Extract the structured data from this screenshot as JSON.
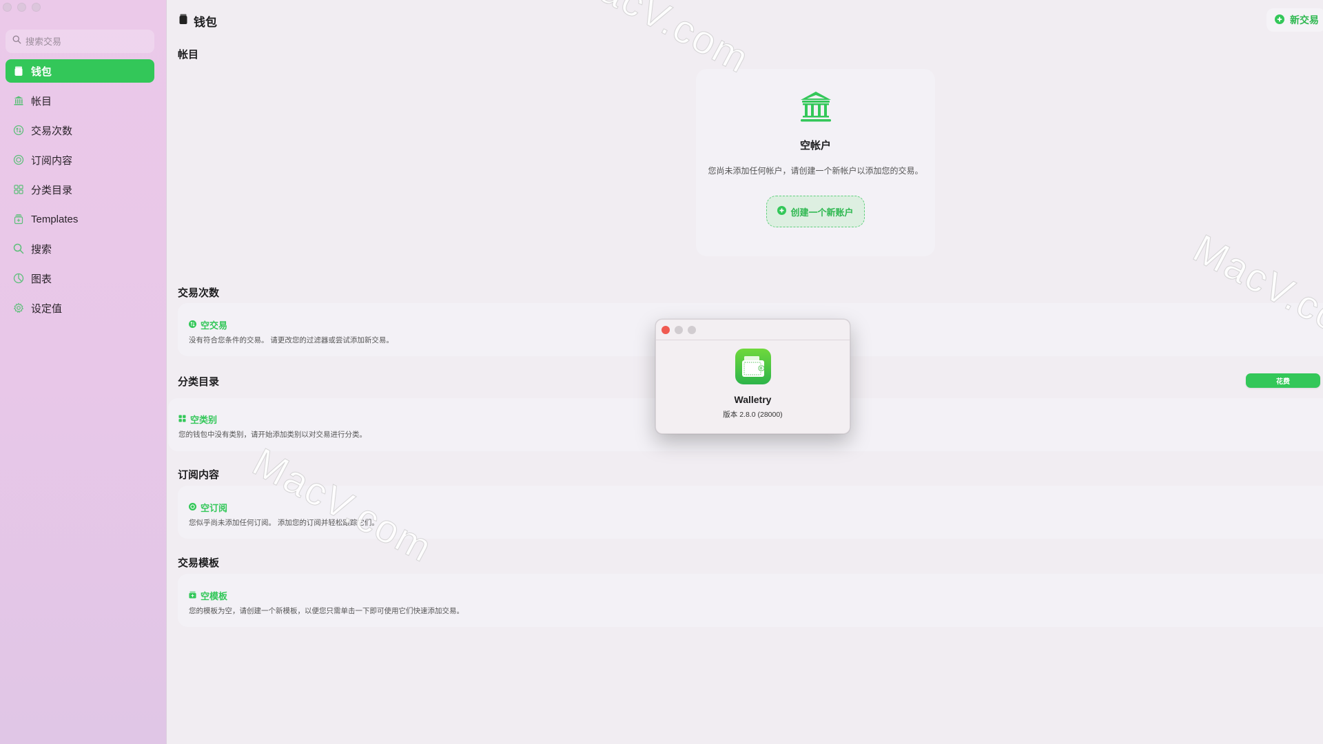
{
  "window": {
    "traffic_lights": [
      "close",
      "minimize",
      "zoom"
    ]
  },
  "sidebar": {
    "search_placeholder": "搜索交易",
    "items": [
      {
        "label": "钱包",
        "icon": "wallet-icon",
        "active": true
      },
      {
        "label": "帐目",
        "icon": "bank-icon",
        "active": false
      },
      {
        "label": "交易次数",
        "icon": "transactions-icon",
        "active": false
      },
      {
        "label": "订阅内容",
        "icon": "subscription-icon",
        "active": false
      },
      {
        "label": "分类目录",
        "icon": "category-grid-icon",
        "active": false
      },
      {
        "label": "Templates",
        "icon": "template-icon",
        "active": false
      },
      {
        "label": "搜索",
        "icon": "search-icon",
        "active": false
      },
      {
        "label": "图表",
        "icon": "chart-icon",
        "active": false
      },
      {
        "label": "设定值",
        "icon": "gear-icon",
        "active": false
      }
    ]
  },
  "header": {
    "title": "钱包",
    "new_transaction_label": "新交易"
  },
  "accounts": {
    "section_title": "帐目",
    "empty_title": "空帐户",
    "empty_text": "您尚未添加任何帐户，请创建一个新帐户以添加您的交易。",
    "create_button": "创建一个新账户"
  },
  "transactions": {
    "section_title": "交易次数",
    "empty_title": "空交易",
    "empty_text": "没有符合您条件的交易。 请更改您的过滤器或尝试添加新交易。"
  },
  "categories": {
    "section_title": "分类目录",
    "filter_button": "花费",
    "empty_title": "空类别",
    "empty_text": "您的钱包中没有类别，请开始添加类别以对交易进行分类。"
  },
  "subscriptions": {
    "section_title": "订阅内容",
    "empty_title": "空订阅",
    "empty_text": "您似乎尚未添加任何订阅。 添加您的订阅并轻松跟踪它们。"
  },
  "templates": {
    "section_title": "交易模板",
    "empty_title": "空模板",
    "empty_text": "您的模板为空，请创建一个新模板，以便您只需单击一下即可使用它们快速添加交易。"
  },
  "about_dialog": {
    "app_name": "Walletry",
    "version": "版本 2.8.0 (28000)"
  },
  "watermark": "MacV.com",
  "colors": {
    "accent": "#33c759",
    "sidebar_bg": "#ebc9e9",
    "content_bg": "#f1edf2",
    "card_bg": "#f3f1f6"
  }
}
